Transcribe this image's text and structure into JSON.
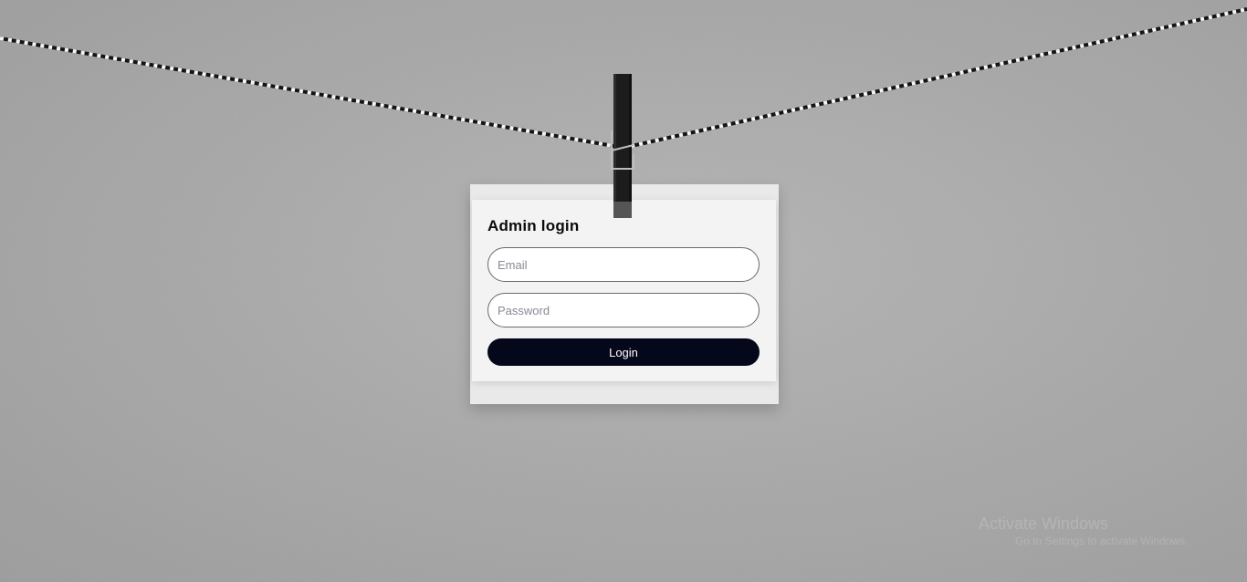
{
  "login": {
    "title": "Admin login",
    "email_placeholder": "Email",
    "password_placeholder": "Password",
    "button_label": "Login"
  },
  "watermark": {
    "title": "Activate Windows",
    "subtitle": "Go to Settings to activate Windows."
  },
  "colors": {
    "button_bg": "#05071a",
    "card_bg": "#f3f3f3",
    "wall": "#a9a9a9",
    "input_border": "#666a70"
  },
  "icons": {
    "clothespin": "clothespin-icon",
    "rope": "twine-rope"
  }
}
